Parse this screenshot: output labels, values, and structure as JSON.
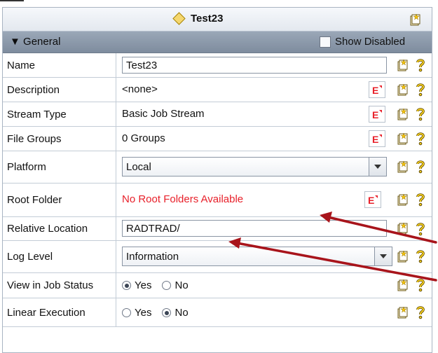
{
  "panel": {
    "title": "Test23"
  },
  "section": {
    "label": "General",
    "show_disabled": "Show Disabled"
  },
  "rows": {
    "name": {
      "label": "Name",
      "value": "Test23"
    },
    "description": {
      "label": "Description",
      "value": "<none>"
    },
    "stream_type": {
      "label": "Stream Type",
      "value": "Basic Job Stream"
    },
    "file_groups": {
      "label": "File Groups",
      "value": "0 Groups"
    },
    "platform": {
      "label": "Platform",
      "value": "Local"
    },
    "root_folder": {
      "label": "Root Folder",
      "value": "No Root Folders Available"
    },
    "relative_location": {
      "label": "Relative Location",
      "value": "RADTRAD/"
    },
    "log_level": {
      "label": "Log Level",
      "value": "Information"
    },
    "view_in_job_status": {
      "label": "View in Job Status",
      "yes": "Yes",
      "no": "No",
      "selected": "Yes"
    },
    "linear_execution": {
      "label": "Linear Execution",
      "yes": "Yes",
      "no": "No",
      "selected": "No"
    }
  },
  "colors": {
    "error_text": "#e8202a",
    "annotation_arrow": "#a8141b",
    "section_bg": "#8a97a8"
  },
  "icons": [
    "diamond-icon",
    "new-item-icon",
    "expand-triangle-icon",
    "checkbox",
    "edit-expression-icon",
    "help-icon",
    "dropdown-arrow-icon"
  ]
}
